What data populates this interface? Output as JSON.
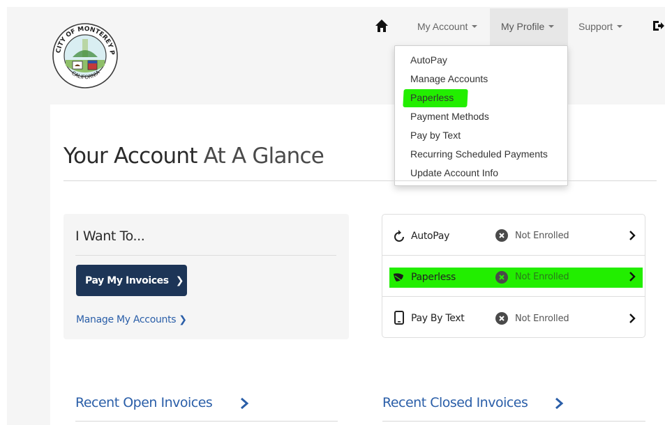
{
  "logo": {
    "ring_text_top": "CITY OF MONTEREY PARK",
    "ring_text_bottom": "CALIFORNIA"
  },
  "nav": {
    "home_icon": "home-icon",
    "items": [
      {
        "label": "My Account"
      },
      {
        "label": "My Profile"
      },
      {
        "label": "Support"
      }
    ],
    "logout_icon": "logout-icon"
  },
  "dropdown": {
    "items": [
      {
        "label": "AutoPay"
      },
      {
        "label": "Manage Accounts"
      },
      {
        "label": "Paperless",
        "highlighted": true
      },
      {
        "label": "Payment Methods"
      },
      {
        "label": "Pay by Text"
      },
      {
        "label": "Recurring Scheduled Payments"
      },
      {
        "label": "Update Account Info"
      }
    ]
  },
  "heading": {
    "part1": "Your Account",
    "part2": "At A Glance"
  },
  "iwant": {
    "title": "I Want To...",
    "pay_button": "Pay My Invoices",
    "manage_link": "Manage My Accounts"
  },
  "enrollments": [
    {
      "label": "AutoPay",
      "icon": "refresh-icon",
      "status": "Not Enrolled",
      "highlighted": false
    },
    {
      "label": "Paperless",
      "icon": "leaf-icon",
      "status": "Not Enrolled",
      "highlighted": true
    },
    {
      "label": "Pay By Text",
      "icon": "mobile-phone-icon",
      "status": "Not Enrolled",
      "highlighted": false
    }
  ],
  "sections": {
    "open_invoices": "Recent Open Invoices",
    "closed_invoices": "Recent Closed Invoices"
  },
  "colors": {
    "highlight": "#22ee00",
    "button_navy": "#1d3557",
    "link_blue": "#2a5ea8",
    "page_gray": "#f5f5f5"
  }
}
